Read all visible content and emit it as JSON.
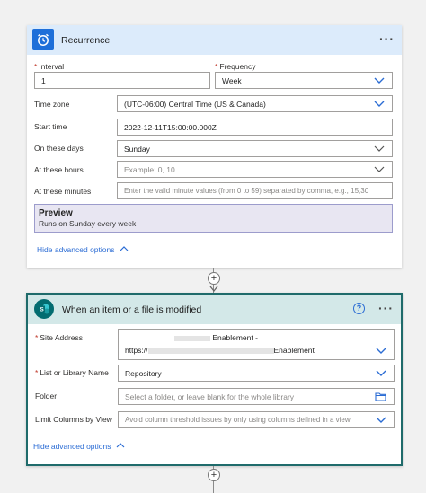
{
  "recurrence": {
    "title": "Recurrence",
    "menu_label": "···",
    "interval": {
      "label": "Interval",
      "value": "1"
    },
    "frequency": {
      "label": "Frequency",
      "value": "Week"
    },
    "time_zone": {
      "label": "Time zone",
      "value": "(UTC-06:00) Central Time (US & Canada)"
    },
    "start_time": {
      "label": "Start time",
      "value": "2022-12-11T15:00:00.000Z"
    },
    "on_these_days": {
      "label": "On these days",
      "value": "Sunday"
    },
    "at_these_hours": {
      "label": "At these hours",
      "placeholder": "Example: 0, 10"
    },
    "at_these_minutes": {
      "label": "At these minutes",
      "placeholder": "Enter the valid minute values (from 0 to 59) separated by comma, e.g., 15,30"
    },
    "preview": {
      "title": "Preview",
      "text": "Runs on Sunday every week"
    },
    "hide_advanced": "Hide advanced options"
  },
  "sharepoint": {
    "title": "When an item or a file is modified",
    "menu_label": "···",
    "help_label": "?",
    "site_address": {
      "label": "Site Address",
      "line1": "Enablement -",
      "line2_prefix": "https://",
      "line2_suffix": "Enablement"
    },
    "list_or_library": {
      "label": "List or Library Name",
      "value": "Repository"
    },
    "folder": {
      "label": "Folder",
      "placeholder": "Select a folder, or leave blank for the whole library"
    },
    "limit_columns": {
      "label": "Limit Columns by View",
      "placeholder": "Avoid column threshold issues by only using columns defined in a view"
    },
    "hide_advanced": "Hide advanced options"
  },
  "connector_plus": "+",
  "colors": {
    "recurrence_icon": "#1e6fd9",
    "sharepoint_icon": "#036c70",
    "link": "#2b6cd4",
    "required": "#c0392b"
  }
}
